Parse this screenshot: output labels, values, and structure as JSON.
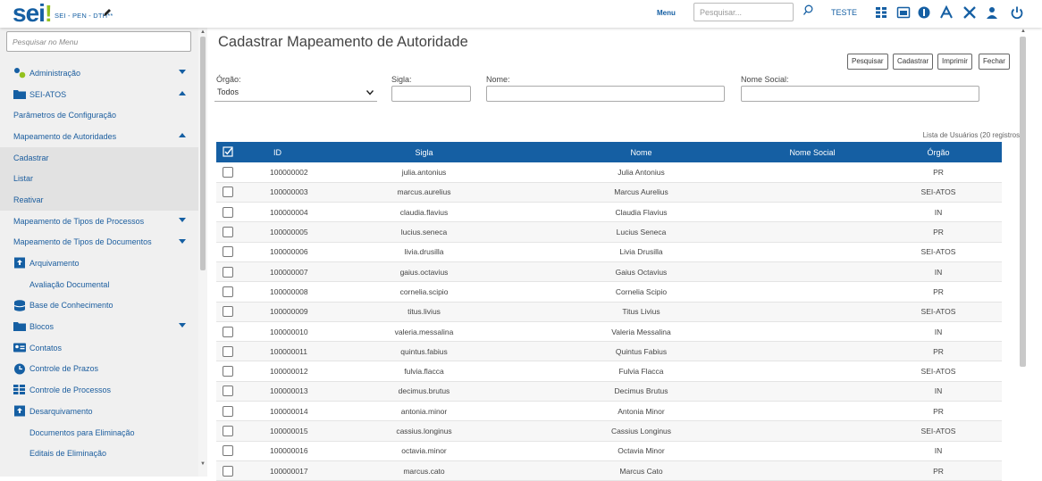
{
  "topbar": {
    "logo": "sei",
    "logo_dot": "!",
    "unit": "SEI - PEN - DTH**",
    "menu_label": "Menu",
    "search_placeholder": "Pesquisar...",
    "user": "TESTE",
    "icons": [
      "search-icon",
      "grid-icon",
      "calendar-icon",
      "shield-icon",
      "font-size-icon",
      "tools-icon",
      "user-icon",
      "power-icon"
    ]
  },
  "sidebar": {
    "search_placeholder": "Pesquisar no Menu",
    "items": [
      {
        "label": "Administração",
        "icon": "gears-icon",
        "arrow": "down"
      },
      {
        "label": "SEI-ATOS",
        "icon": "folder-icon",
        "arrow": "up"
      },
      {
        "label": "Parâmetros de Configuração"
      },
      {
        "label": "Mapeamento de Autoridades",
        "arrow": "up"
      },
      {
        "label": "Cadastrar"
      },
      {
        "label": "Listar"
      },
      {
        "label": "Reativar"
      },
      {
        "label": "Mapeamento de Tipos de Processos",
        "arrow": "down"
      },
      {
        "label": "Mapeamento de Tipos de Documentos",
        "arrow": "down"
      },
      {
        "label": "Arquivamento",
        "icon": "archive-icon"
      },
      {
        "label": "Avaliação Documental"
      },
      {
        "label": "Base de Conhecimento",
        "icon": "database-icon"
      },
      {
        "label": "Blocos",
        "icon": "folder-icon",
        "arrow": "down"
      },
      {
        "label": "Contatos",
        "icon": "contact-card-icon"
      },
      {
        "label": "Controle de Prazos",
        "icon": "clock-icon"
      },
      {
        "label": "Controle de Processos",
        "icon": "list-icon"
      },
      {
        "label": "Desarquivamento",
        "icon": "archive-icon"
      },
      {
        "label": "Documentos para Eliminação"
      },
      {
        "label": "Editais de Eliminação"
      }
    ]
  },
  "main": {
    "title": "Cadastrar Mapeamento de Autoridade",
    "buttons": {
      "search": "Pesquisar",
      "create": "Cadastrar",
      "print": "Imprimir",
      "close": "Fechar"
    },
    "filters": {
      "orgao_label": "Órgão:",
      "orgao_value": "Todos",
      "sigla_label": "Sigla:",
      "nome_label": "Nome:",
      "nome_social_label": "Nome Social:"
    },
    "count": "Lista de Usuários (20 registros):",
    "columns": [
      "ID",
      "Sigla",
      "Nome",
      "Nome Social",
      "Órgão"
    ],
    "rows": [
      {
        "id": "100000002",
        "sigla": "julia.antonius",
        "nome": "Julia Antonius",
        "nome_social": "",
        "orgao": "PR"
      },
      {
        "id": "100000003",
        "sigla": "marcus.aurelius",
        "nome": "Marcus Aurelius",
        "nome_social": "",
        "orgao": "SEI-ATOS"
      },
      {
        "id": "100000004",
        "sigla": "claudia.flavius",
        "nome": "Claudia Flavius",
        "nome_social": "",
        "orgao": "IN"
      },
      {
        "id": "100000005",
        "sigla": "lucius.seneca",
        "nome": "Lucius Seneca",
        "nome_social": "",
        "orgao": "PR"
      },
      {
        "id": "100000006",
        "sigla": "livia.drusilla",
        "nome": "Livia Drusilla",
        "nome_social": "",
        "orgao": "SEI-ATOS"
      },
      {
        "id": "100000007",
        "sigla": "gaius.octavius",
        "nome": "Gaius Octavius",
        "nome_social": "",
        "orgao": "IN"
      },
      {
        "id": "100000008",
        "sigla": "cornelia.scipio",
        "nome": "Cornelia Scipio",
        "nome_social": "",
        "orgao": "PR"
      },
      {
        "id": "100000009",
        "sigla": "titus.livius",
        "nome": "Titus Livius",
        "nome_social": "",
        "orgao": "SEI-ATOS"
      },
      {
        "id": "100000010",
        "sigla": "valeria.messalina",
        "nome": "Valeria Messalina",
        "nome_social": "",
        "orgao": "IN"
      },
      {
        "id": "100000011",
        "sigla": "quintus.fabius",
        "nome": "Quintus Fabius",
        "nome_social": "",
        "orgao": "PR"
      },
      {
        "id": "100000012",
        "sigla": "fulvia.flacca",
        "nome": "Fulvia Flacca",
        "nome_social": "",
        "orgao": "SEI-ATOS"
      },
      {
        "id": "100000013",
        "sigla": "decimus.brutus",
        "nome": "Decimus Brutus",
        "nome_social": "",
        "orgao": "IN"
      },
      {
        "id": "100000014",
        "sigla": "antonia.minor",
        "nome": "Antonia Minor",
        "nome_social": "",
        "orgao": "PR"
      },
      {
        "id": "100000015",
        "sigla": "cassius.longinus",
        "nome": "Cassius Longinus",
        "nome_social": "",
        "orgao": "SEI-ATOS"
      },
      {
        "id": "100000016",
        "sigla": "octavia.minor",
        "nome": "Octavia Minor",
        "nome_social": "",
        "orgao": "IN"
      },
      {
        "id": "100000017",
        "sigla": "marcus.cato",
        "nome": "Marcus Cato",
        "nome_social": "",
        "orgao": "PR"
      }
    ]
  },
  "colors": {
    "brand": "#155fa3",
    "accent": "#94c11f",
    "sidebar_bg": "#f0f0f0"
  }
}
